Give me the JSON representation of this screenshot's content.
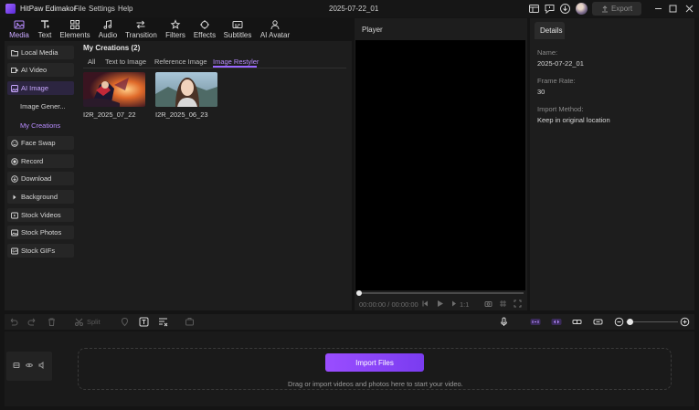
{
  "app": {
    "name": "HitPaw Edimakor"
  },
  "menu": [
    "File",
    "Settings",
    "Help"
  ],
  "project_title": "2025-07-22_01",
  "export_label": "Export",
  "tools": [
    {
      "label": "Media",
      "icon": "media-icon"
    },
    {
      "label": "Text",
      "icon": "text-icon"
    },
    {
      "label": "Elements",
      "icon": "elements-icon"
    },
    {
      "label": "Audio",
      "icon": "audio-icon"
    },
    {
      "label": "Transition",
      "icon": "transition-icon"
    },
    {
      "label": "Filters",
      "icon": "filters-icon"
    },
    {
      "label": "Effects",
      "icon": "effects-icon"
    },
    {
      "label": "Subtitles",
      "icon": "subtitles-icon"
    },
    {
      "label": "AI Avatar",
      "icon": "ai-avatar-icon"
    }
  ],
  "sidebar": {
    "items": [
      {
        "label": "Local Media",
        "icon": "folder-icon"
      },
      {
        "label": "AI Video",
        "icon": "ai-video-icon"
      },
      {
        "label": "AI Image",
        "icon": "ai-image-icon"
      },
      {
        "label": "Image Gener...",
        "sub": true
      },
      {
        "label": "My Creations",
        "sub": true
      },
      {
        "label": "Face Swap",
        "icon": "face-swap-icon"
      },
      {
        "label": "Record",
        "icon": "record-icon"
      },
      {
        "label": "Download",
        "icon": "download-icon"
      },
      {
        "label": "Background",
        "icon": "background-icon"
      },
      {
        "label": "Stock Videos",
        "icon": "stock-videos-icon"
      },
      {
        "label": "Stock Photos",
        "icon": "stock-photos-icon"
      },
      {
        "label": "Stock GIFs",
        "icon": "stock-gifs-icon"
      }
    ]
  },
  "creations": {
    "title": "My Creations (2)",
    "tabs": [
      "All",
      "Text to Image",
      "Reference Image",
      "Image Restyler"
    ],
    "items": [
      {
        "label": "I2R_2025_07_22"
      },
      {
        "label": "I2R_2025_06_23"
      }
    ]
  },
  "player": {
    "title": "Player",
    "current_time": "00:00:00",
    "separator": "/",
    "total_time": "00:00:00",
    "speed": "1:1"
  },
  "details": {
    "tab": "Details",
    "name_label": "Name:",
    "name_value": "2025-07-22_01",
    "frame_rate_label": "Frame Rate:",
    "frame_rate_value": "30",
    "import_method_label": "Import Method:",
    "import_method_value": "Keep in original location"
  },
  "timeline": {
    "split_label": "Split",
    "import_button": "Import Files",
    "drop_hint": "Drag or import videos and photos here to start your video."
  },
  "colors": {
    "accent": "#9a66ff",
    "accent_text": "#b88cff",
    "button_gradient_start": "#9a4dff",
    "button_gradient_end": "#7a3cf0"
  }
}
